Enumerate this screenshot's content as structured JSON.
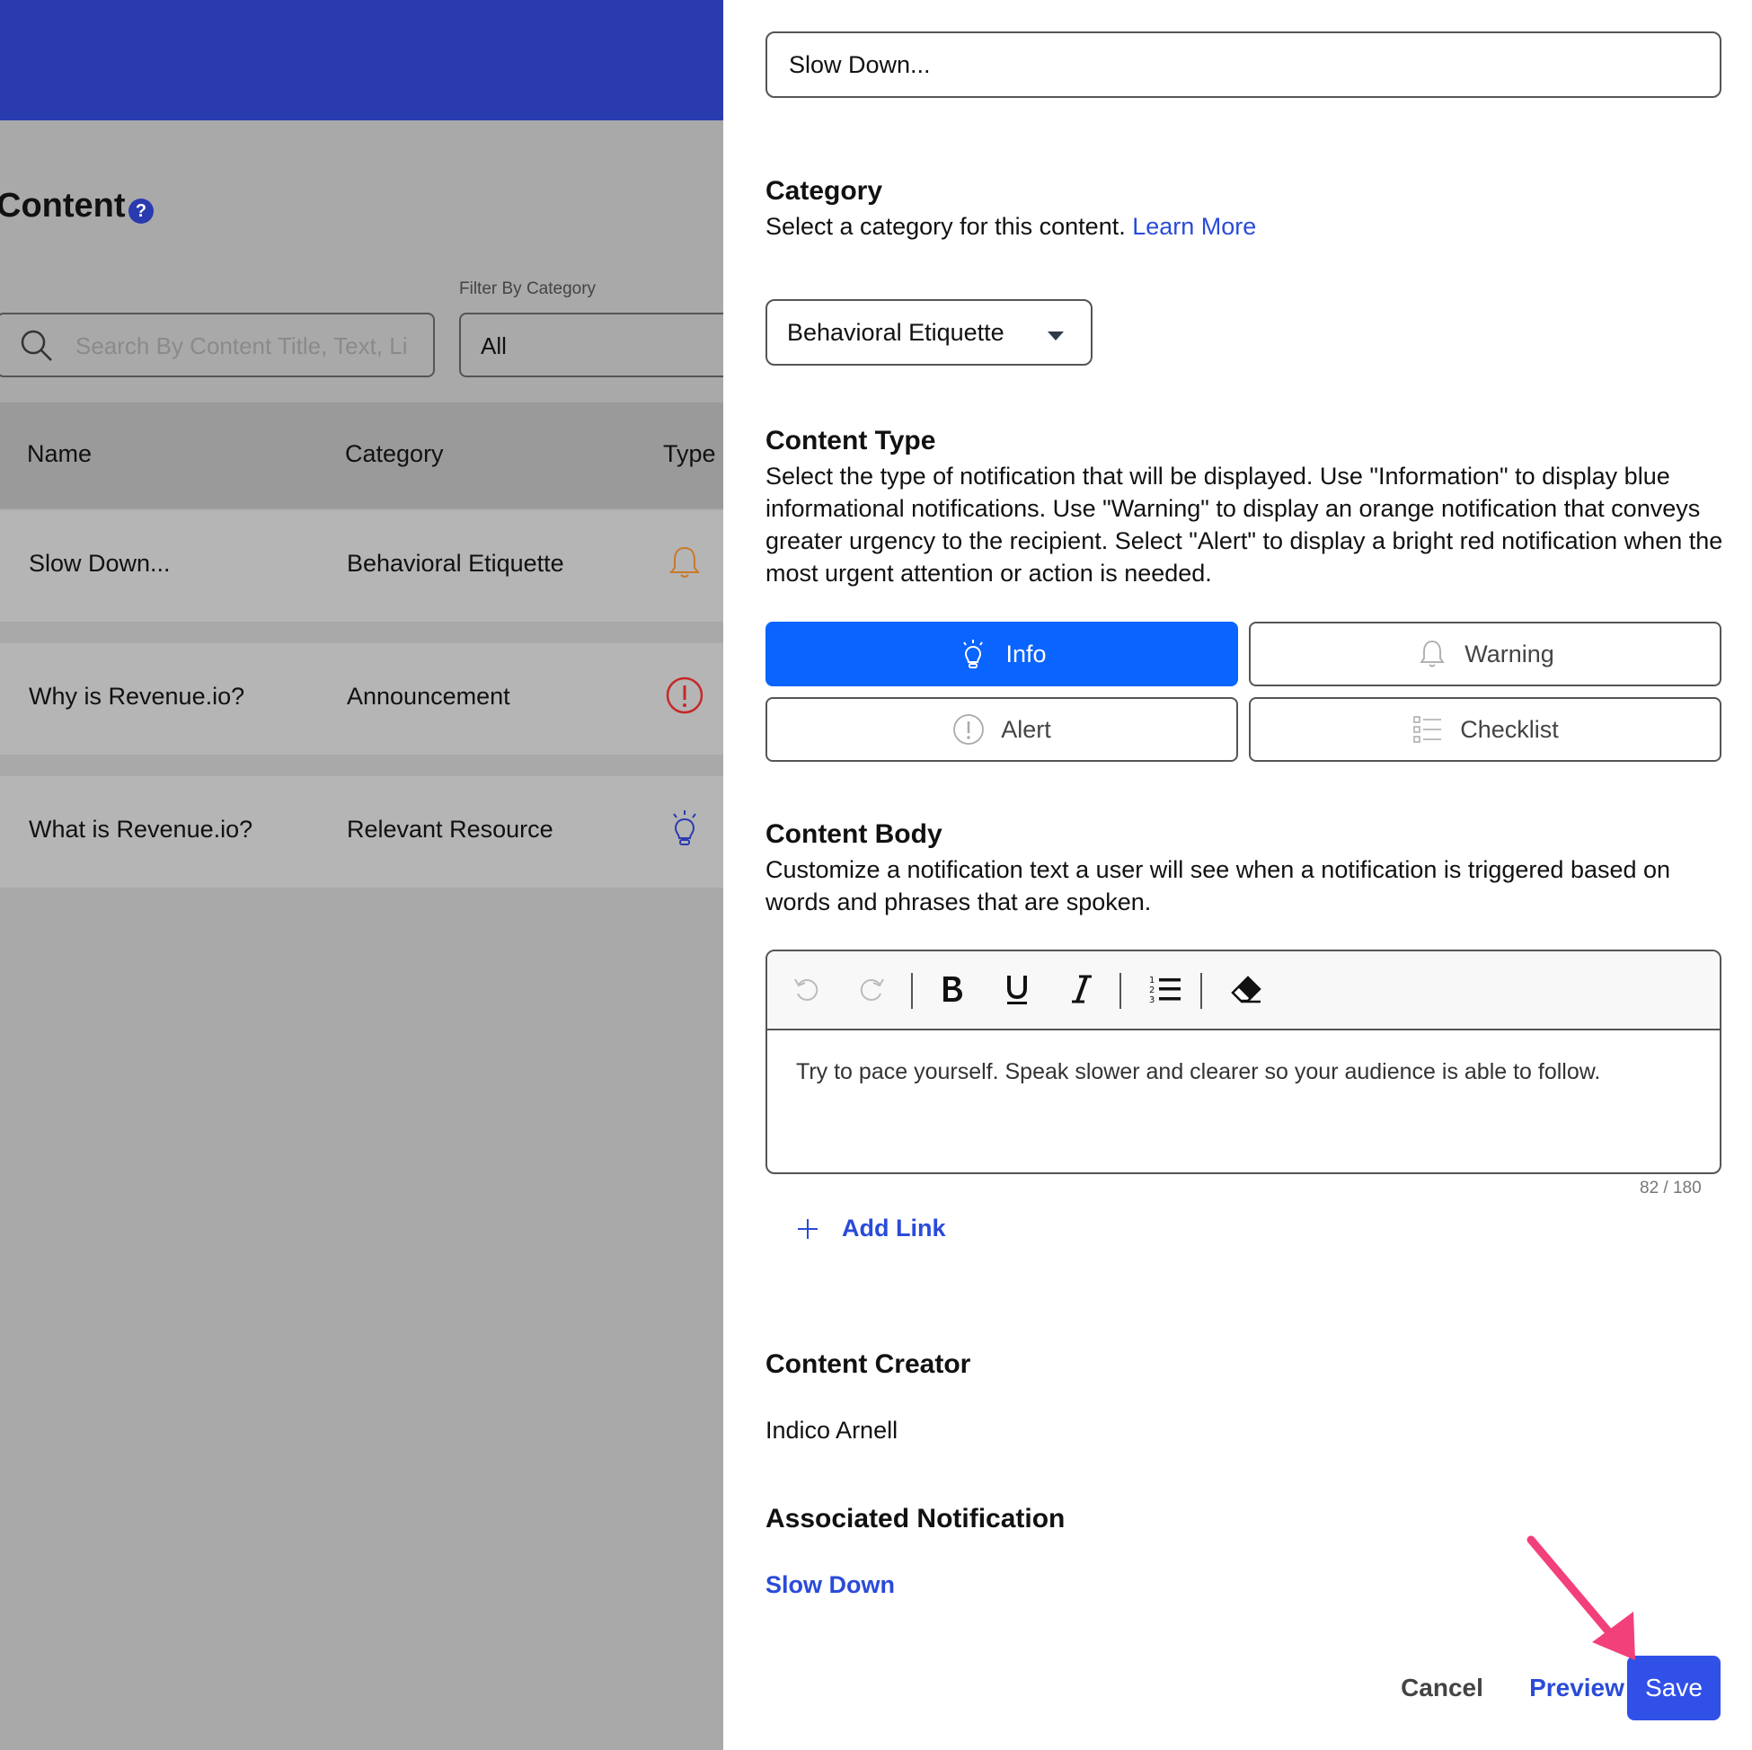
{
  "page": {
    "title": "Content",
    "help_label": "?",
    "search_placeholder": "Search By Content Title, Text, Li",
    "filter_label": "Filter By Category",
    "filter_value": "All",
    "table": {
      "columns": [
        "Name",
        "Category",
        "Type"
      ],
      "rows": [
        {
          "name": "Slow Down...",
          "category": "Behavioral Etiquette",
          "icon": "bell-icon",
          "icon_color": "#c97a2a"
        },
        {
          "name": "Why is Revenue.io?",
          "category": "Announcement",
          "icon": "alert-icon",
          "icon_color": "#c62828"
        },
        {
          "name": "What is Revenue.io?",
          "category": "Relevant Resource",
          "icon": "lightbulb-icon",
          "icon_color": "#2a3bb0"
        }
      ]
    }
  },
  "panel": {
    "title_value": "Slow Down...",
    "category": {
      "heading": "Category",
      "description": "Select a category for this content.",
      "learn_more": "Learn More",
      "selected": "Behavioral Etiquette"
    },
    "content_type": {
      "heading": "Content Type",
      "description": "Select the type of notification that will be displayed. Use \"Information\" to display blue informational notifications. Use \"Warning\" to display an orange notification that conveys greater urgency to the recipient. Select \"Alert\" to display a bright red notification when the most urgent attention or action is needed.",
      "options": [
        {
          "label": "Info",
          "icon": "lightbulb-icon",
          "selected": true
        },
        {
          "label": "Warning",
          "icon": "bell-icon",
          "selected": false
        },
        {
          "label": "Alert",
          "icon": "alert-icon",
          "selected": false
        },
        {
          "label": "Checklist",
          "icon": "checklist-icon",
          "selected": false
        }
      ]
    },
    "content_body": {
      "heading": "Content Body",
      "description": "Customize a notification text a user will see when a notification is triggered based on words and phrases that are spoken.",
      "text": "Try to pace yourself. Speak slower and clearer so your audience is able to follow.",
      "counter": "82 / 180",
      "toolbar": [
        "undo-icon",
        "redo-icon",
        "bold-icon",
        "underline-icon",
        "italic-icon",
        "numbered-list-icon",
        "eraser-icon"
      ]
    },
    "add_link": "Add Link",
    "creator": {
      "heading": "Content Creator",
      "name": "Indico Arnell"
    },
    "associated": {
      "heading": "Associated Notification",
      "link": "Slow Down"
    },
    "footer": {
      "cancel": "Cancel",
      "preview": "Preview",
      "save": "Save"
    }
  },
  "colors": {
    "brand": "#2a3bb0",
    "primary": "#0a64ff",
    "save": "#3150e8",
    "link": "#2a4bd9",
    "annotation_arrow": "#f2407a"
  }
}
